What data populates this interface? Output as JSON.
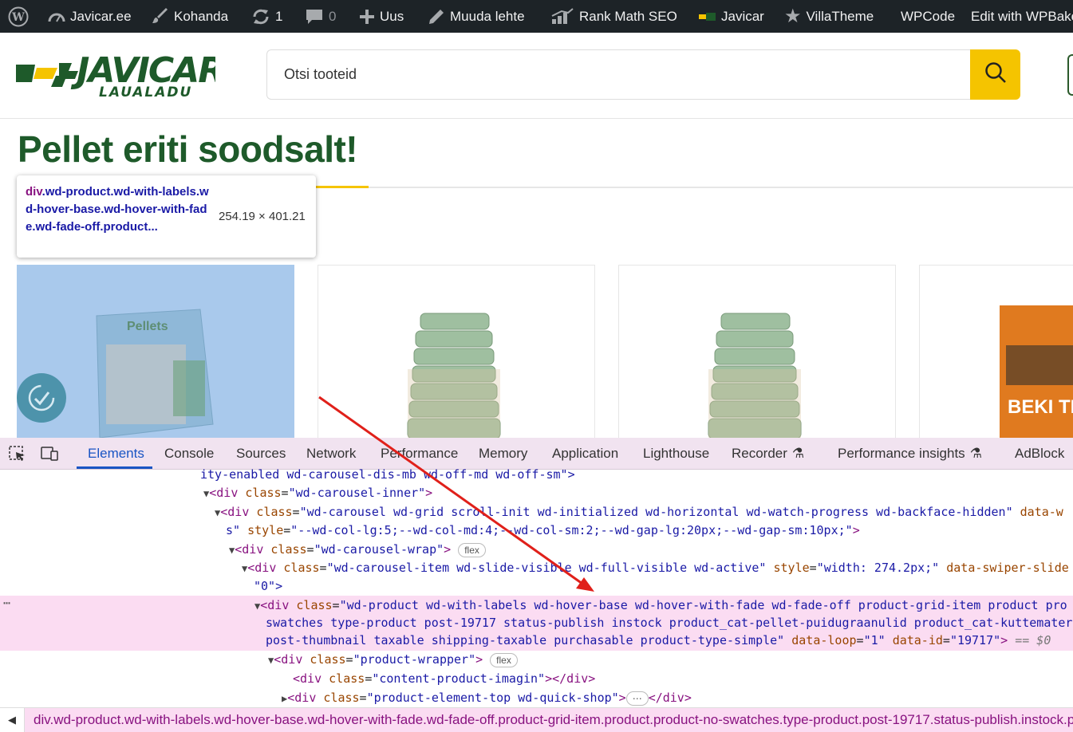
{
  "admin_bar": {
    "site_name": "Javicar.ee",
    "customize": "Kohanda",
    "updates_count": "1",
    "comments_count": "0",
    "new": "Uus",
    "edit_page": "Muuda lehte",
    "rank_math": "Rank Math SEO",
    "javicar": "Javicar",
    "villatheme": "VillaTheme",
    "wpcode": "WPCode",
    "wpbakery": "Edit with WPBakery"
  },
  "header": {
    "logo_text": "JAVICAR",
    "logo_sub": "LAUALADU",
    "search_placeholder": "Otsi tooteid"
  },
  "page": {
    "heading": "Pellet eriti soodsalt!"
  },
  "inspect_tooltip": {
    "selector_tag": "div",
    "selector_classes": ".wd-product.wd-with-labels.wd-hover-base.wd-hover-with-fade.wd-fade-off.product...",
    "dimensions": "254.19 × 401.21"
  },
  "products": [
    {
      "image_label": "Pellets"
    },
    {
      "image_label": ""
    },
    {
      "image_label": ""
    },
    {
      "image_label": "BEKI TIMBER"
    }
  ],
  "devtools": {
    "tabs": [
      "Elements",
      "Console",
      "Sources",
      "Network",
      "Performance",
      "Memory",
      "Application",
      "Lighthouse",
      "Recorder",
      "Performance insights",
      "AdBlock"
    ],
    "active_tab": "Elements",
    "lines": {
      "l1": "ity-enabled wd-carousel-dis-mb wd-off-md wd-off-sm\">",
      "l2_tag": "div",
      "l2_attr": "class",
      "l2_val": "\"wd-carousel-inner\"",
      "l3_val": "\"wd-carousel wd-grid scroll-init wd-initialized wd-horizontal wd-watch-progress wd-backface-hidden\"",
      "l3_extra": "data-w",
      "l4_pre": "s\"",
      "l4_attr": "style",
      "l4_val": "\"--wd-col-lg:5;--wd-col-md:4;--wd-col-sm:2;--wd-gap-lg:20px;--wd-gap-sm:10px;\"",
      "l5_val": "\"wd-carousel-wrap\"",
      "flex": "flex",
      "l6_val": "\"wd-carousel-item wd-slide-visible wd-full-visible wd-active\"",
      "l6_style": "\"width: 274.2px;\"",
      "l6_extra_attr": "data-swiper-slide",
      "l7": "\"0\">",
      "l8_val": "\"wd-product wd-with-labels wd-hover-base wd-hover-with-fade wd-fade-off product-grid-item product pro",
      "l9": "swatches type-product post-19717 status-publish instock product_cat-pellet-puidugraanulid product_cat-kuttemater",
      "l10_a": "post-thumbnail taxable shipping-taxable purchasable product-type-simple\"",
      "l10_loop_attr": "data-loop",
      "l10_loop_val": "\"1\"",
      "l10_id_attr": "data-id",
      "l10_id_val": "\"19717\"",
      "l10_eq": "== $0",
      "l11_val": "\"product-wrapper\"",
      "l12_val": "\"content-product-imagin\"",
      "l13_val": "\"product-element-top wd-quick-shop\"",
      "ellipsis": "⋯"
    },
    "breadcrumb": "div.wd-product.wd-with-labels.wd-hover-base.wd-hover-with-fade.wd-fade-off.product-grid-item.product.product-no-swatches.type-product.post-19717.status-publish.instock.product_cat-pellet-puidugraanulid"
  }
}
